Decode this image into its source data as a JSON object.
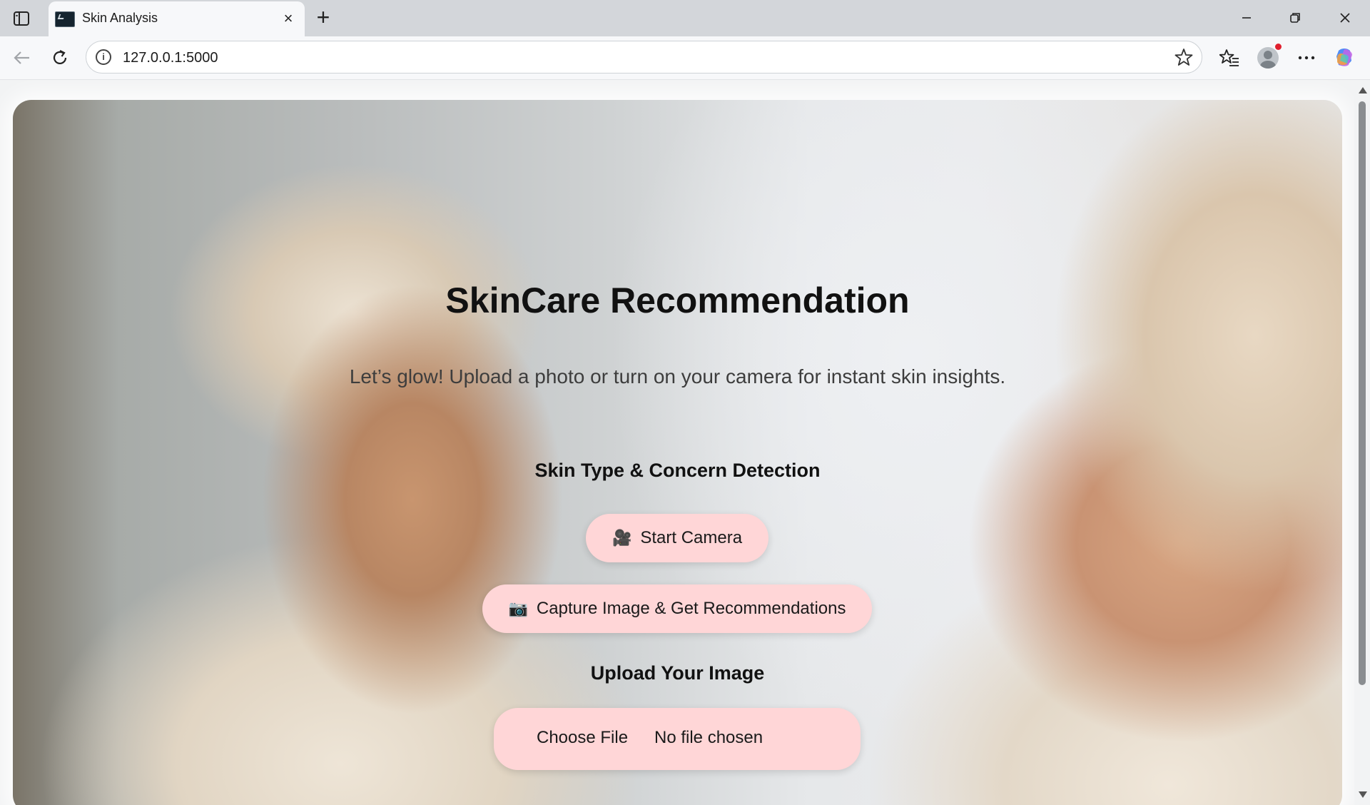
{
  "browser": {
    "tab_title": "Skin Analysis",
    "url": "127.0.0.1:5000"
  },
  "page": {
    "title": "SkinCare Recommendation",
    "subtitle": "Let’s glow! Upload a photo or turn on your camera for instant skin insights.",
    "detection_heading": "Skin Type & Concern Detection",
    "start_camera_label": "Start Camera",
    "start_camera_icon": "🎥",
    "capture_label": "Capture Image & Get Recommendations",
    "capture_icon": "📷",
    "upload_heading": "Upload Your Image",
    "choose_file_label": "Choose File",
    "no_file_text": "No file chosen"
  },
  "colors": {
    "button_bg": "#ffd6d7",
    "heading": "#111111"
  }
}
